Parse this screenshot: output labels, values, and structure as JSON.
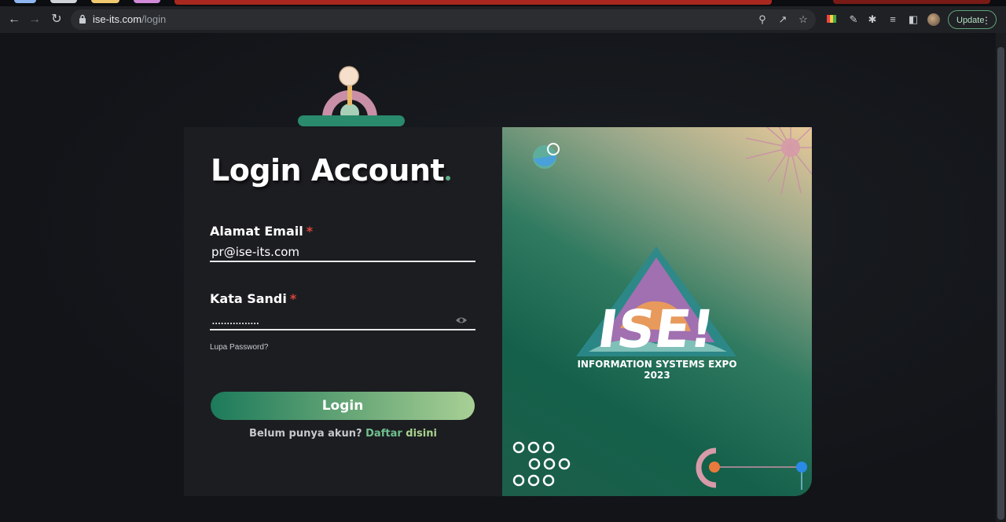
{
  "browser": {
    "url_host": "ise-its.com",
    "url_path": "/login",
    "update_label": "Update"
  },
  "login": {
    "title": "Login Account",
    "email_label": "Alamat Email",
    "email_value": "pr@ise-its.com",
    "password_label": "Kata Sandi",
    "password_value": "................",
    "required_mark": "*",
    "forgot_link": "Lupa Password?",
    "submit_label": "Login",
    "signup_prompt": "Belum punya akun?",
    "signup_link_1": "Daftar",
    "signup_link_2": "disini"
  },
  "banner": {
    "logo_text": "ISE!",
    "caption_line1": "INFORMATION SYSTEMS EXPO",
    "caption_line2": "2023"
  },
  "colors": {
    "accent_green": "#1c7a5b",
    "link_green": "#6fbf8e",
    "required_red": "#d9443a",
    "card_bg": "#1c1d21"
  }
}
